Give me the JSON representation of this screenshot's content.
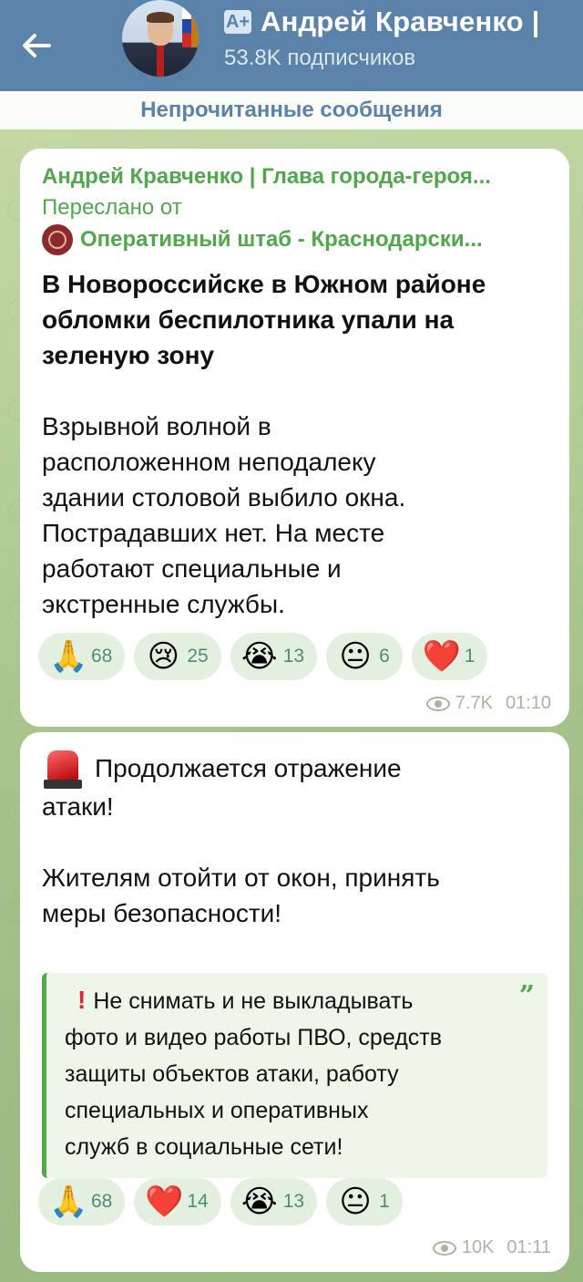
{
  "header": {
    "title": "Андрей Кравченко |",
    "subtitle": "53.8K подписчиков",
    "badge": "A+"
  },
  "unread_label": "Непрочитанные сообщения",
  "messages": [
    {
      "forward_author": "Андрей Кравченко | Глава города-героя...",
      "forward_label": "Переслано от",
      "forward_source": "Оперативный штаб - Краснодарски...",
      "heading": [
        "В Новороссийске в Южном районе",
        "обломки беспилотника упали на",
        "зеленую зону"
      ],
      "body": [
        "Взрывной волной в",
        "расположенном неподалеку",
        "здании столовой выбило окна.",
        "Пострадавших нет. На месте",
        "работают специальные и",
        "экстренные службы."
      ],
      "reactions": [
        {
          "emoji": "🙏",
          "count": "68"
        },
        {
          "emoji": "😢",
          "count": "25"
        },
        {
          "emoji": "😭",
          "count": "13"
        },
        {
          "emoji": "😐",
          "count": "6"
        },
        {
          "emoji": "❤️",
          "count": "1"
        }
      ],
      "views": "7.7K",
      "time": "01:10"
    },
    {
      "body_first": [
        "Продолжается отражение",
        "атаки!"
      ],
      "body_second": [
        "Жителям отойти от окон, принять",
        "меры безопасности!"
      ],
      "quote": [
        "Не снимать и не выкладывать",
        "фото и видео работы ПВО, средств",
        "защиты объектов атаки, работу",
        "специальных и оперативных",
        "служб в социальные сети!"
      ],
      "quote_mark": "”",
      "reactions": [
        {
          "emoji": "🙏",
          "count": "68"
        },
        {
          "emoji": "❤️",
          "count": "14"
        },
        {
          "emoji": "😭",
          "count": "13"
        },
        {
          "emoji": "😐",
          "count": "1"
        }
      ],
      "views": "10K",
      "time": "01:11"
    }
  ],
  "colors": {
    "header_bg": "#5b82a9",
    "accent_green": "#4fa84a",
    "reaction_bg": "#e4f0df",
    "alert_red": "#e0242d"
  },
  "icons": {
    "back": "arrow-left-icon",
    "views": "eye-icon",
    "siren": "siren-icon",
    "exclamation": "exclamation-icon",
    "quote": "quote-icon"
  }
}
